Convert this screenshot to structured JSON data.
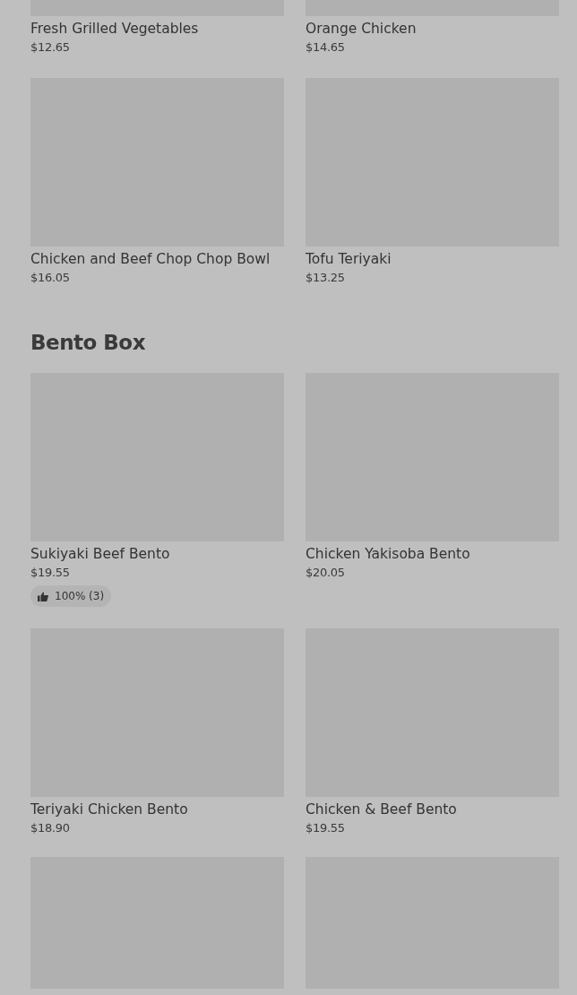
{
  "sections": [
    {
      "items": [
        {
          "kind": "dish",
          "name": "Fresh Grilled Vegetables",
          "price": "$12.65"
        },
        {
          "kind": "dish",
          "name": "Orange Chicken",
          "price": "$14.65"
        },
        {
          "kind": "dish",
          "name": "Chicken and Beef Chop Chop Bowl",
          "price": "$16.05"
        },
        {
          "kind": "dish",
          "name": "Tofu Teriyaki",
          "price": "$13.25"
        }
      ]
    },
    {
      "heading": "Bento Box",
      "items": [
        {
          "kind": "dish",
          "name": "Sukiyaki Beef Bento",
          "price": "$19.55",
          "rating": "100% (3)"
        },
        {
          "kind": "dish",
          "name": "Chicken Yakisoba Bento",
          "price": "$20.05"
        },
        {
          "kind": "dish",
          "name": "Teriyaki Chicken Bento",
          "price": "$18.90"
        },
        {
          "kind": "dish",
          "name": "Chicken & Beef Bento",
          "price": "$19.55"
        },
        {
          "kind": "picture"
        },
        {
          "kind": "picture"
        }
      ]
    }
  ]
}
